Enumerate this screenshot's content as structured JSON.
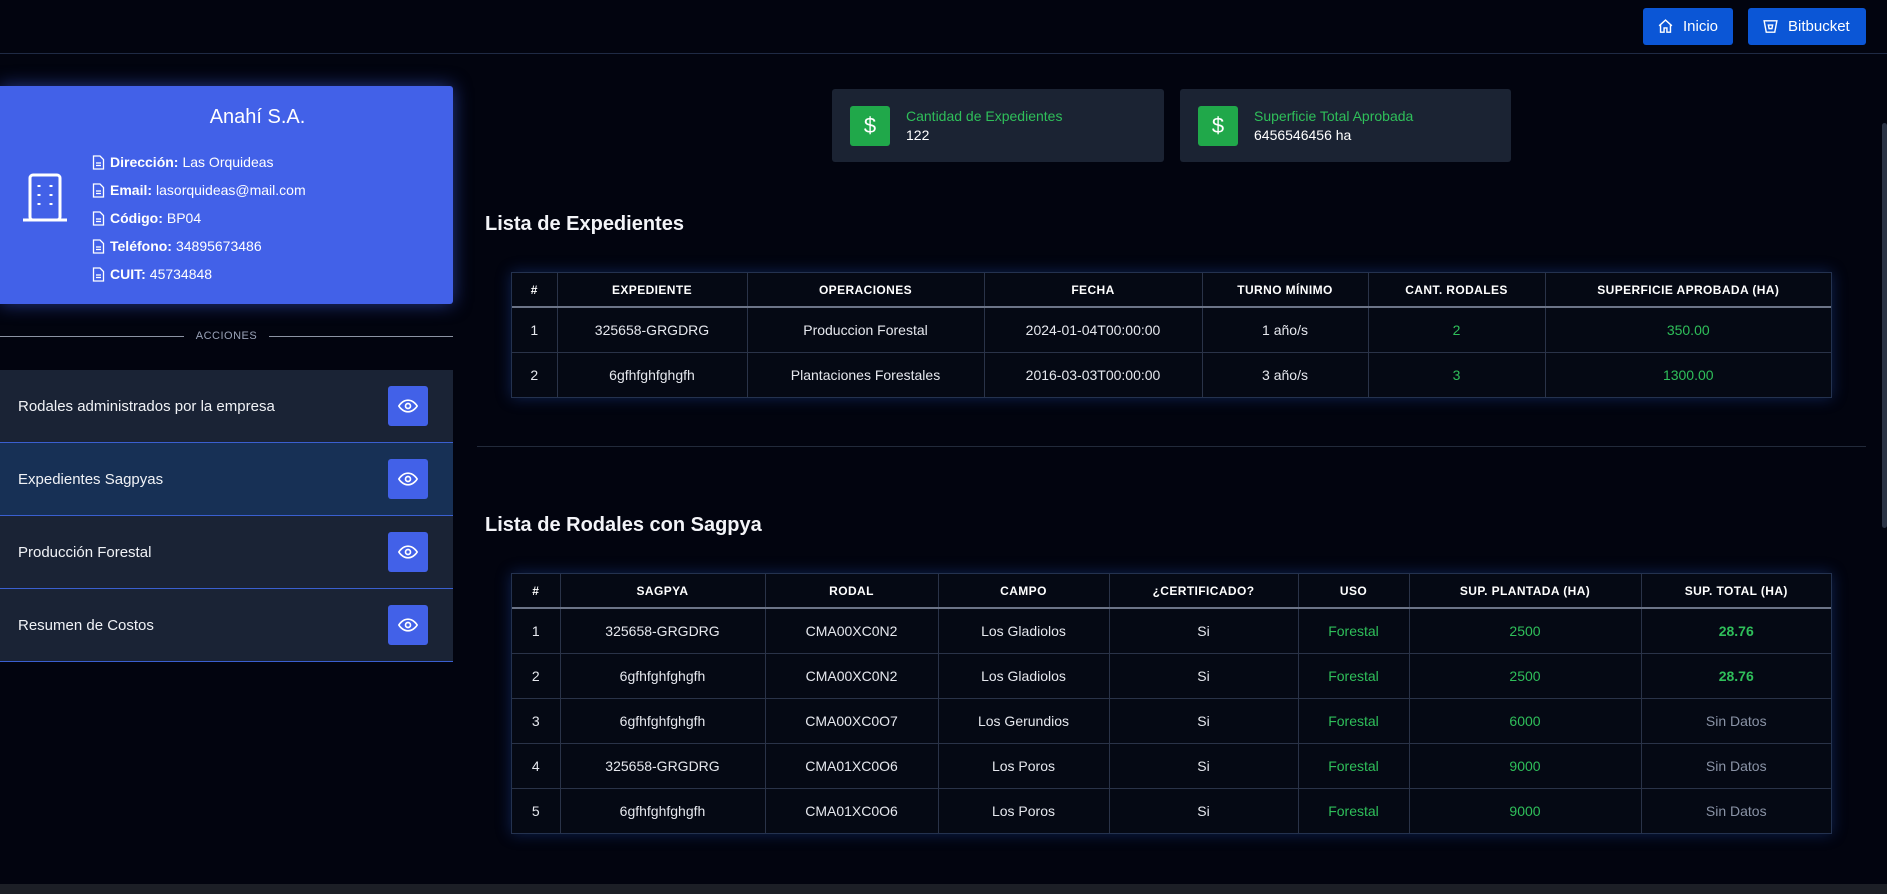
{
  "topbar": {
    "inicio_label": "Inicio",
    "bitbucket_label": "Bitbucket"
  },
  "company": {
    "name": "Anahí S.A.",
    "fields": [
      {
        "label": "Dirección:",
        "value": "Las Orquideas"
      },
      {
        "label": "Email:",
        "value": "lasorquideas@mail.com"
      },
      {
        "label": "Código:",
        "value": "BP04"
      },
      {
        "label": "Teléfono:",
        "value": "34895673486"
      },
      {
        "label": "CUIT:",
        "value": "45734848"
      }
    ]
  },
  "acciones_label": "ACCIONES",
  "actions": [
    {
      "label": "Rodales administrados por la empresa"
    },
    {
      "label": "Expedientes Sagpyas"
    },
    {
      "label": "Producción Forestal"
    },
    {
      "label": "Resumen de Costos"
    }
  ],
  "stats": [
    {
      "label": "Cantidad de Expedientes",
      "value": "122",
      "icon": "$"
    },
    {
      "label": "Superficie Total Aprobada",
      "value": "6456546456 ha",
      "icon": "$"
    }
  ],
  "expedientes": {
    "title": "Lista de Expedientes",
    "headers": [
      "#",
      "EXPEDIENTE",
      "OPERACIONES",
      "FECHA",
      "TURNO MÍNIMO",
      "CANT. RODALES",
      "SUPERFICIE APROBADA (HA)"
    ],
    "rows": [
      [
        "1",
        "325658-GRGDRG",
        "Produccion Forestal",
        "2024-01-04T00:00:00",
        "1 año/s",
        "2",
        "350.00"
      ],
      [
        "2",
        "6gfhfghfghgfh",
        "Plantaciones Forestales",
        "2016-03-03T00:00:00",
        "3 año/s",
        "3",
        "1300.00"
      ]
    ]
  },
  "rodales": {
    "title": "Lista de Rodales con Sagpya",
    "headers": [
      "#",
      "SAGPYA",
      "RODAL",
      "CAMPO",
      "¿CERTIFICADO?",
      "USO",
      "SUP. PLANTADA (HA)",
      "SUP. TOTAL (HA)"
    ],
    "rows": [
      [
        "1",
        "325658-GRGDRG",
        "CMA00XC0N2",
        "Los Gladiolos",
        "Si",
        "Forestal",
        "2500",
        "28.76"
      ],
      [
        "2",
        "6gfhfghfghgfh",
        "CMA00XC0N2",
        "Los Gladiolos",
        "Si",
        "Forestal",
        "2500",
        "28.76"
      ],
      [
        "3",
        "6gfhfghfghgfh",
        "CMA00XC0O7",
        "Los Gerundios",
        "Si",
        "Forestal",
        "6000",
        "Sin Datos"
      ],
      [
        "4",
        "325658-GRGDRG",
        "CMA01XC0O6",
        "Los Poros",
        "Si",
        "Forestal",
        "9000",
        "Sin Datos"
      ],
      [
        "5",
        "6gfhfghfghgfh",
        "CMA01XC0O6",
        "Los Poros",
        "Si",
        "Forestal",
        "9000",
        "Sin Datos"
      ]
    ]
  },
  "colors": {
    "accent": "#4261e8",
    "topbar_button": "#0b56d6",
    "success": "#2fbf5a",
    "background": "#02040f"
  }
}
